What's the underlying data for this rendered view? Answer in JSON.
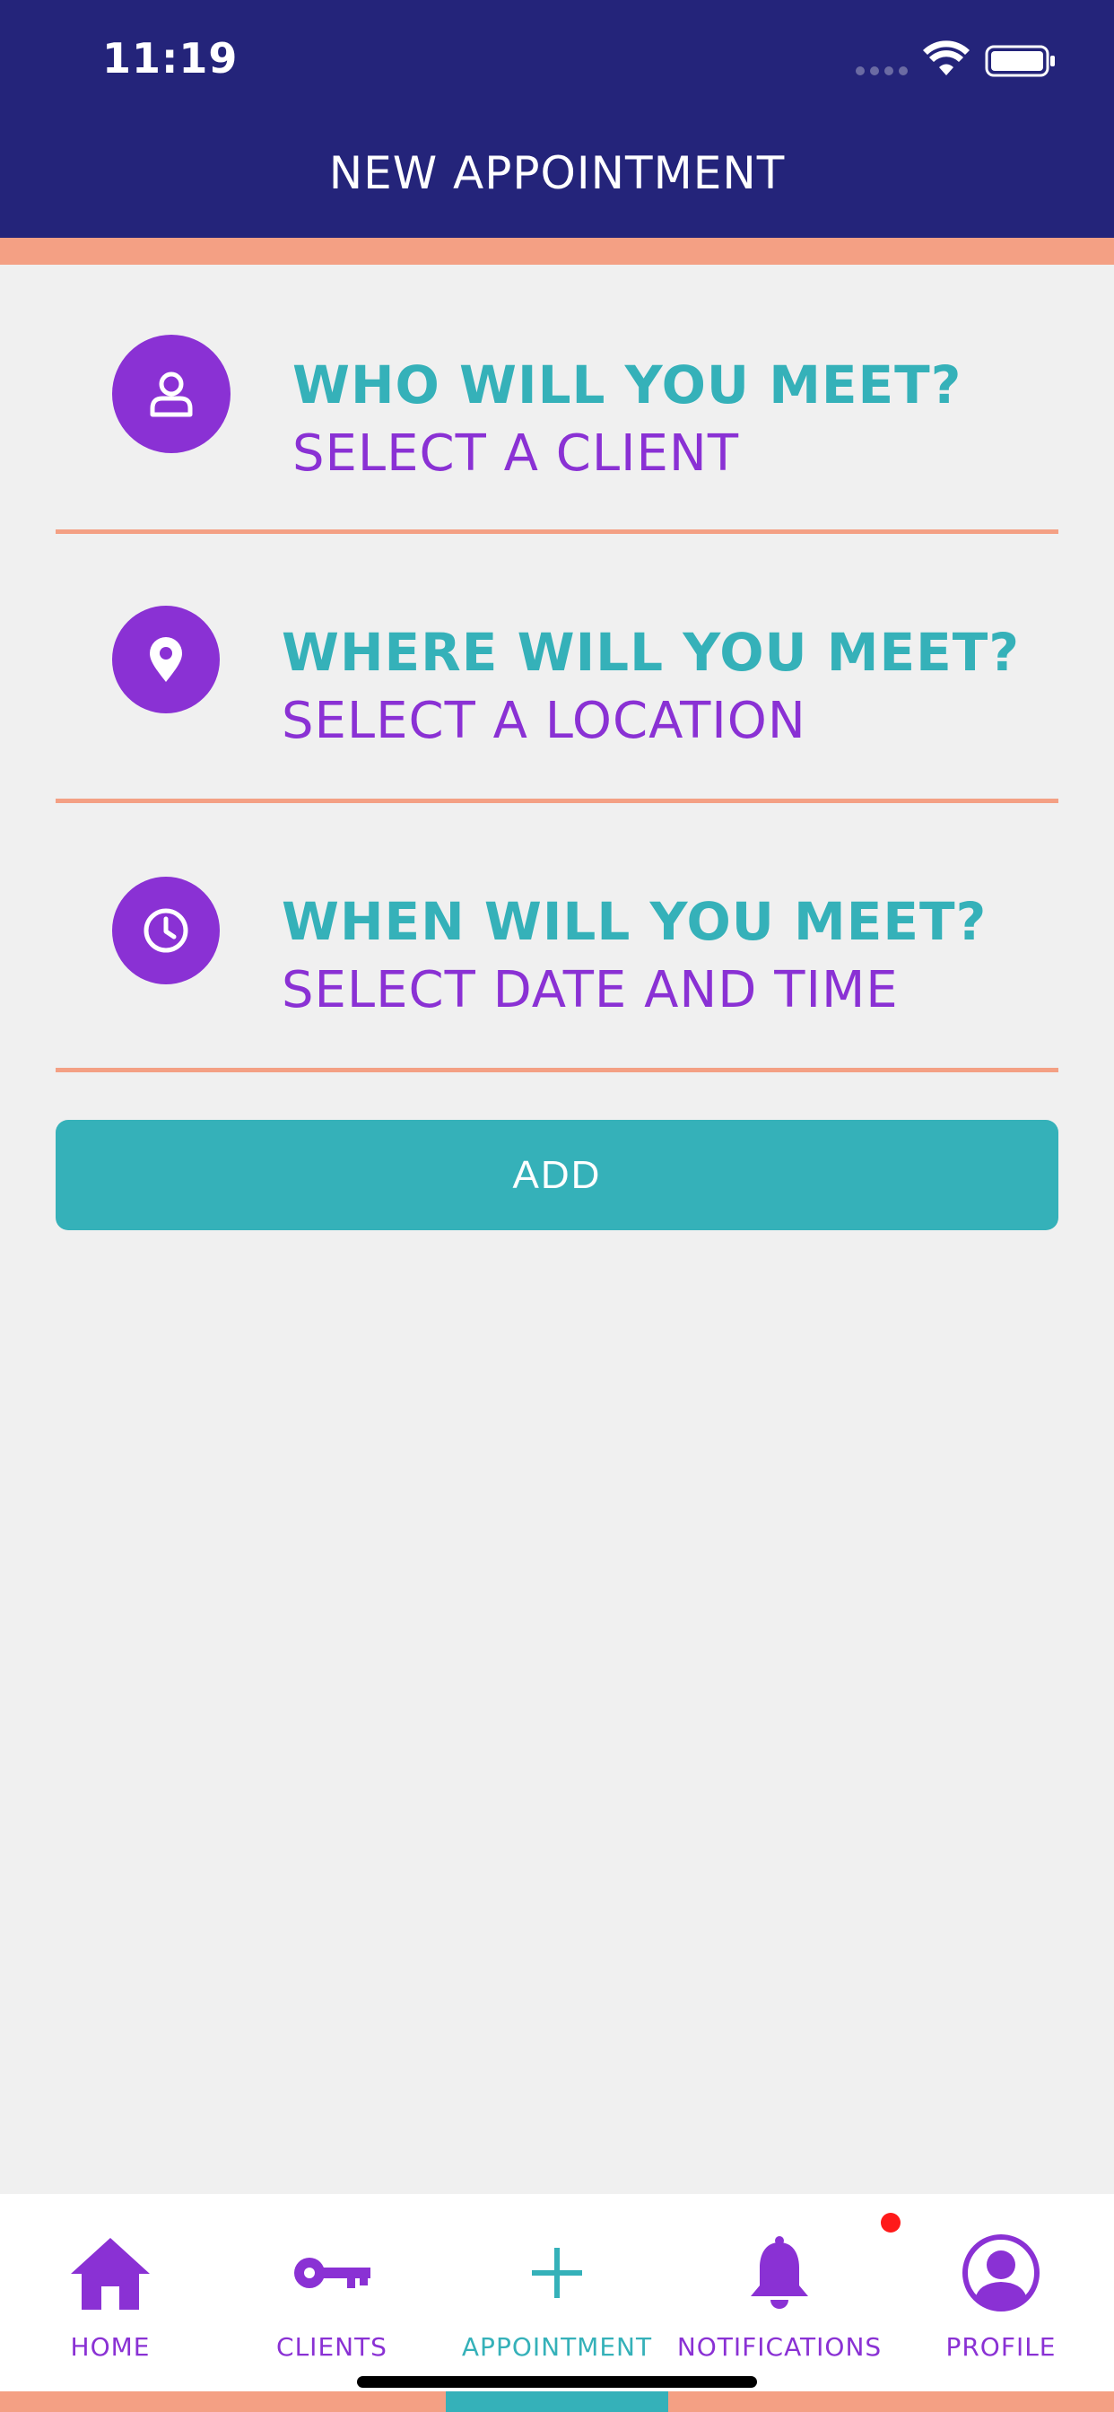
{
  "status_bar": {
    "time": "11:19"
  },
  "header": {
    "title": "NEW APPOINTMENT"
  },
  "rows": [
    {
      "title": "WHO WILL YOU MEET?",
      "subtitle": "SELECT A CLIENT",
      "icon": "person-icon"
    },
    {
      "title": "WHERE WILL YOU MEET?",
      "subtitle": "SELECT A LOCATION",
      "icon": "location-pin-icon"
    },
    {
      "title": "WHEN WILL YOU MEET?",
      "subtitle": "SELECT DATE AND TIME",
      "icon": "clock-icon"
    }
  ],
  "add_button": {
    "label": "ADD"
  },
  "tabs": [
    {
      "label": "HOME",
      "icon": "home-icon"
    },
    {
      "label": "CLIENTS",
      "icon": "key-icon"
    },
    {
      "label": "APPOINTMENT",
      "icon": "plus-icon",
      "active": true
    },
    {
      "label": "NOTIFICATIONS",
      "icon": "bell-icon",
      "has_badge": true
    },
    {
      "label": "PROFILE",
      "icon": "profile-icon"
    }
  ],
  "colors": {
    "header_bg": "#24247a",
    "accent": "#f4a084",
    "teal": "#35b1b9",
    "purple": "#8a31d4",
    "background": "#f0f0f0",
    "badge": "#ff1a1a"
  }
}
